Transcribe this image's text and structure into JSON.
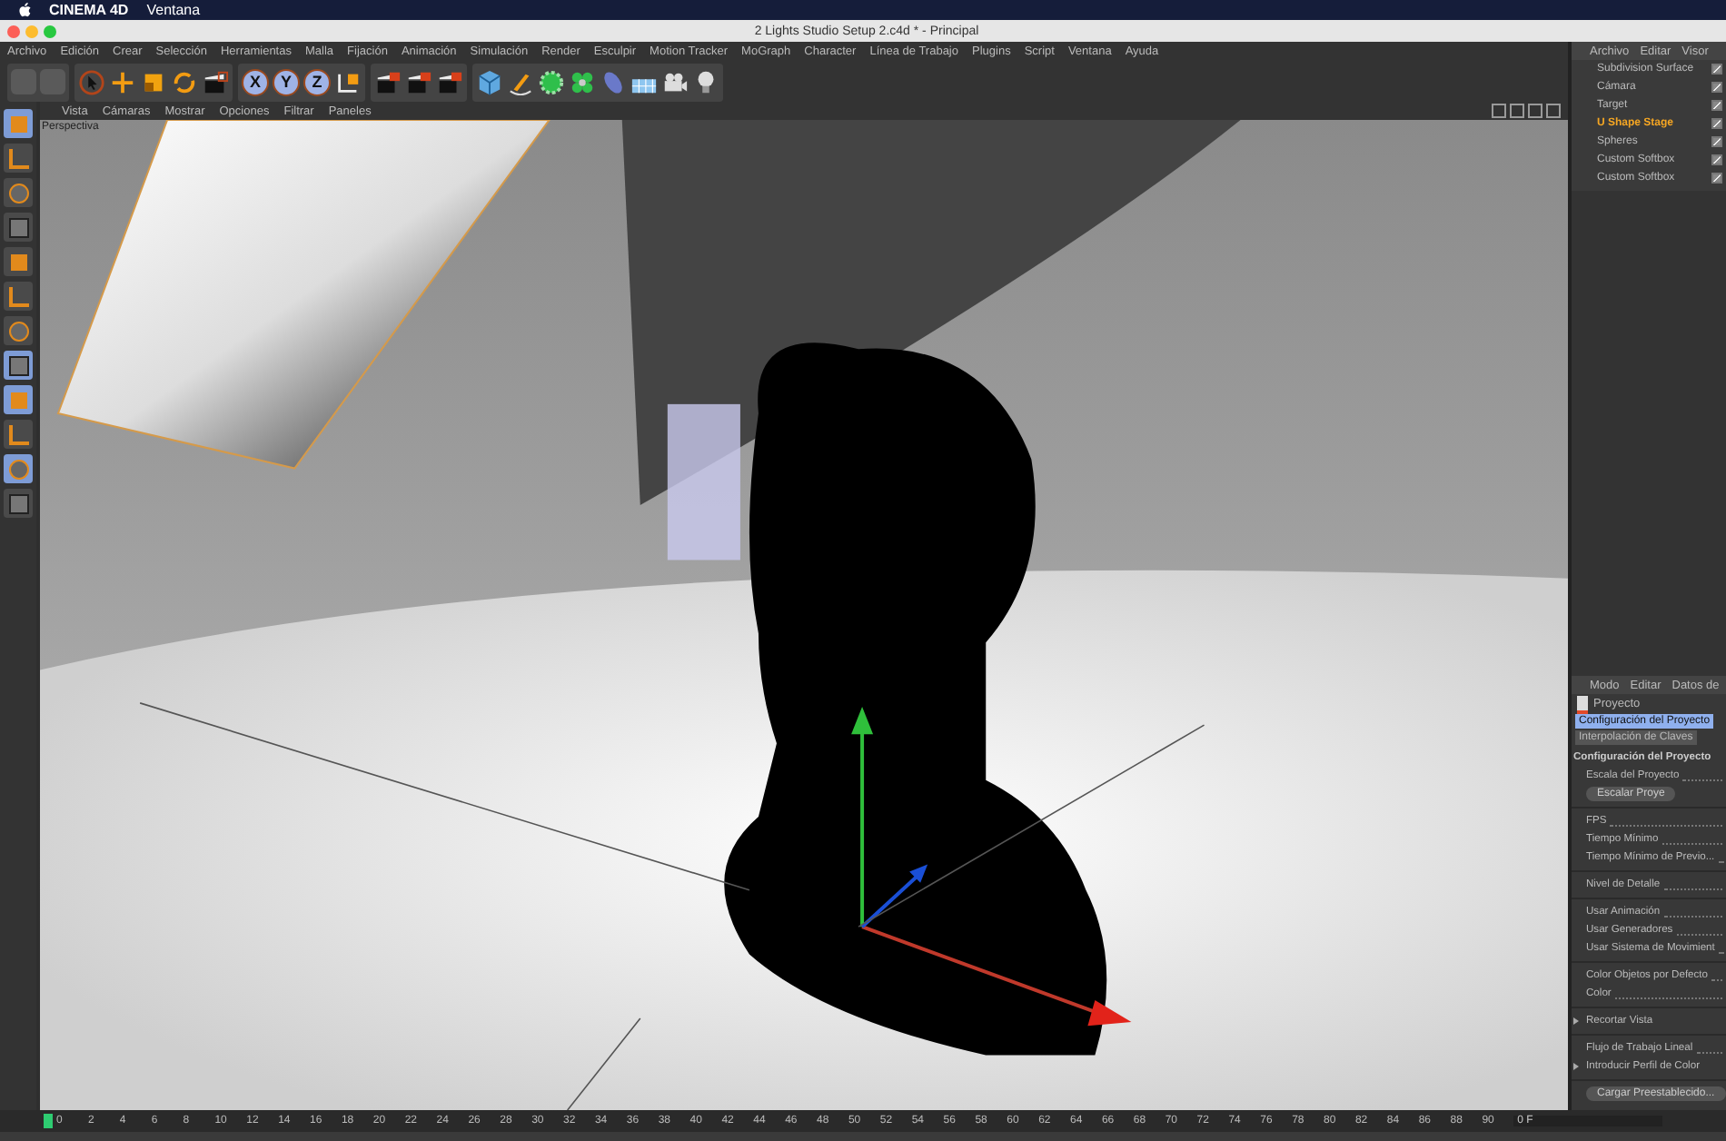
{
  "mac_menu": {
    "app": "CINEMA 4D",
    "items": [
      "Ventana"
    ]
  },
  "window": {
    "title": "2 Lights Studio Setup 2.c4d * - Principal"
  },
  "menu": [
    "Archivo",
    "Edición",
    "Crear",
    "Selección",
    "Herramientas",
    "Malla",
    "Fijación",
    "Animación",
    "Simulación",
    "Render",
    "Esculpir",
    "Motion Tracker",
    "MoGraph",
    "Character",
    "Línea de Trabajo",
    "Plugins",
    "Script",
    "Ventana",
    "Ayuda"
  ],
  "axis_buttons": [
    "X",
    "Y",
    "Z"
  ],
  "viewport": {
    "menu": [
      "Vista",
      "Cámaras",
      "Mostrar",
      "Opciones",
      "Filtrar",
      "Paneles"
    ],
    "camera_label": "Perspectiva"
  },
  "object_manager": {
    "menu": [
      "Archivo",
      "Editar",
      "Visor"
    ],
    "objects": [
      {
        "name": "Subdivision Surface",
        "selected": false,
        "checked": true
      },
      {
        "name": "Cámara",
        "selected": false,
        "checked": true
      },
      {
        "name": "Target",
        "selected": false,
        "checked": true
      },
      {
        "name": "U Shape Stage",
        "selected": true,
        "checked": true
      },
      {
        "name": "Spheres",
        "selected": false,
        "checked": true
      },
      {
        "name": "Custom Softbox",
        "selected": false,
        "checked": true
      },
      {
        "name": "Custom Softbox",
        "selected": false,
        "checked": true
      }
    ]
  },
  "attributes": {
    "menu": [
      "Modo",
      "Editar",
      "Datos de"
    ],
    "object": "Proyecto",
    "tabs": [
      {
        "label": "Configuración del Proyecto",
        "selected": true
      },
      {
        "label": "Interpolación de Claves",
        "selected": false
      }
    ],
    "section": "Configuración del Proyecto",
    "rows": [
      {
        "kind": "field",
        "label": "Escala del Proyecto"
      },
      {
        "kind": "button",
        "label": "Escalar Proye"
      },
      {
        "kind": "rule"
      },
      {
        "kind": "field",
        "label": "FPS"
      },
      {
        "kind": "field",
        "label": "Tiempo Mínimo"
      },
      {
        "kind": "field",
        "label": "Tiempo Mínimo de Previo..."
      },
      {
        "kind": "rule"
      },
      {
        "kind": "field",
        "label": "Nivel de Detalle"
      },
      {
        "kind": "rule"
      },
      {
        "kind": "field",
        "label": "Usar Animación"
      },
      {
        "kind": "field",
        "label": "Usar Generadores"
      },
      {
        "kind": "field",
        "label": "Usar Sistema de Movimient"
      },
      {
        "kind": "rule"
      },
      {
        "kind": "field",
        "label": "Color Objetos por Defecto"
      },
      {
        "kind": "field",
        "label": "Color"
      },
      {
        "kind": "rule"
      },
      {
        "kind": "group",
        "label": "Recortar Vista"
      },
      {
        "kind": "rule"
      },
      {
        "kind": "field",
        "label": "Flujo de Trabajo Lineal"
      },
      {
        "kind": "group",
        "label": "Introducir Perfil de Color"
      },
      {
        "kind": "rule"
      },
      {
        "kind": "button",
        "label": "Cargar Preestablecido..."
      }
    ]
  },
  "timeline": {
    "ticks": [
      "0",
      "2",
      "4",
      "6",
      "8",
      "10",
      "12",
      "14",
      "16",
      "18",
      "20",
      "22",
      "24",
      "26",
      "28",
      "30",
      "32",
      "34",
      "36",
      "38",
      "40",
      "42",
      "44",
      "46",
      "48",
      "50",
      "52",
      "54",
      "56",
      "58",
      "60",
      "62",
      "64",
      "66",
      "68",
      "70",
      "72",
      "74",
      "76",
      "78",
      "80",
      "82",
      "84",
      "86",
      "88",
      "90"
    ],
    "frame": "0 F"
  }
}
